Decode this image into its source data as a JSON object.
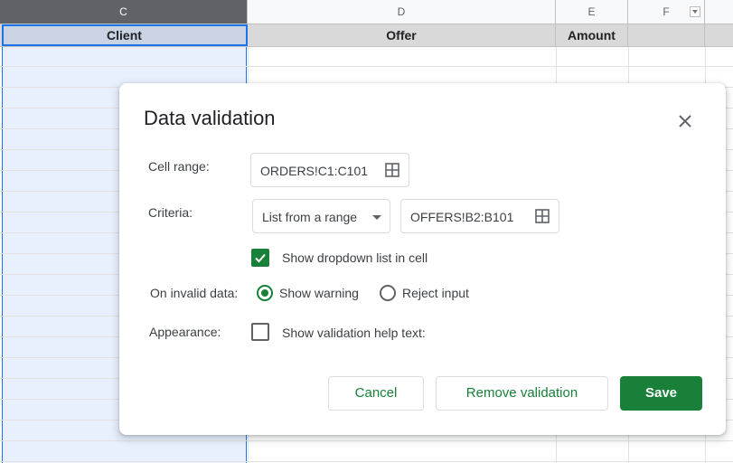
{
  "sheet": {
    "columns": [
      "C",
      "D",
      "E",
      "F"
    ],
    "headers": [
      "Client",
      "Offer",
      "Amount",
      ""
    ]
  },
  "dialog": {
    "title": "Data validation",
    "cell_range_label": "Cell range:",
    "cell_range_value": "ORDERS!C1:C101",
    "criteria_label": "Criteria:",
    "criteria_type": "List from a range",
    "criteria_range": "OFFERS!B2:B101",
    "show_dropdown_label": "Show dropdown list in cell",
    "show_dropdown_checked": true,
    "on_invalid_label": "On invalid data:",
    "show_warning_label": "Show warning",
    "reject_input_label": "Reject input",
    "on_invalid_selected": "Show warning",
    "appearance_label": "Appearance:",
    "help_text_label": "Show validation help text:",
    "help_text_checked": false,
    "cancel_label": "Cancel",
    "remove_label": "Remove validation",
    "save_label": "Save"
  },
  "colors": {
    "accent": "#188038",
    "selection": "#1a73e8"
  },
  "icons": [
    "close-icon",
    "grid-icon",
    "filter-icon",
    "checkmark-icon",
    "chevron-down-icon"
  ]
}
